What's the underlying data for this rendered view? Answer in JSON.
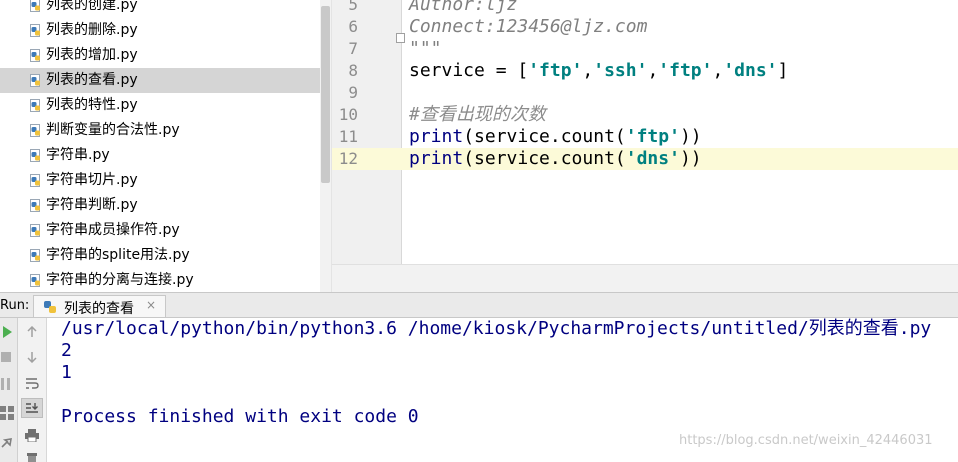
{
  "project_tree": {
    "items": [
      {
        "name": "列表的创建.py",
        "selected": false
      },
      {
        "name": "列表的删除.py",
        "selected": false
      },
      {
        "name": "列表的增加.py",
        "selected": false
      },
      {
        "name": "列表的查看.py",
        "selected": true
      },
      {
        "name": "列表的特性.py",
        "selected": false
      },
      {
        "name": "判断变量的合法性.py",
        "selected": false
      },
      {
        "name": "字符串.py",
        "selected": false
      },
      {
        "name": "字符串切片.py",
        "selected": false
      },
      {
        "name": "字符串判断.py",
        "selected": false
      },
      {
        "name": "字符串成员操作符.py",
        "selected": false
      },
      {
        "name": "字符串的splite用法.py",
        "selected": false
      },
      {
        "name": "字符串的分离与连接.py",
        "selected": false
      }
    ]
  },
  "editor": {
    "lines": [
      {
        "num": "5",
        "parts": [
          {
            "t": "docstr",
            "v": "Author:ljz"
          }
        ]
      },
      {
        "num": "6",
        "parts": [
          {
            "t": "docstr",
            "v": "Connect:123456@ljz.com"
          }
        ]
      },
      {
        "num": "7",
        "parts": [
          {
            "t": "docstr",
            "v": "\"\"\""
          }
        ]
      },
      {
        "num": "8",
        "parts": [
          {
            "t": "plain",
            "v": "service = ["
          },
          {
            "t": "str",
            "v": "'ftp'"
          },
          {
            "t": "plain",
            "v": ","
          },
          {
            "t": "str",
            "v": "'ssh'"
          },
          {
            "t": "plain",
            "v": ","
          },
          {
            "t": "str",
            "v": "'ftp'"
          },
          {
            "t": "plain",
            "v": ","
          },
          {
            "t": "str",
            "v": "'dns'"
          },
          {
            "t": "plain",
            "v": "]"
          }
        ]
      },
      {
        "num": "9",
        "parts": []
      },
      {
        "num": "10",
        "parts": [
          {
            "t": "comment",
            "v": "#查看出现的次数"
          }
        ]
      },
      {
        "num": "11",
        "parts": [
          {
            "t": "fn",
            "v": "print"
          },
          {
            "t": "plain",
            "v": "(service.count("
          },
          {
            "t": "str",
            "v": "'ftp'"
          },
          {
            "t": "plain",
            "v": "))"
          }
        ]
      },
      {
        "num": "12",
        "parts": [
          {
            "t": "fn",
            "v": "print"
          },
          {
            "t": "plain",
            "v": "(service.count("
          },
          {
            "t": "str",
            "v": "'dns'"
          },
          {
            "t": "plain",
            "v": "))"
          }
        ],
        "current": true
      }
    ]
  },
  "run": {
    "label": "Run:",
    "tab_label": "列表的查看",
    "tab_close": "×",
    "console": [
      {
        "cls": "c-cmd",
        "v": "/usr/local/python/bin/python3.6 /home/kiosk/PycharmProjects/untitled/列表的查看.py"
      },
      {
        "cls": "c-out",
        "v": "2"
      },
      {
        "cls": "c-out",
        "v": "1"
      },
      {
        "cls": "c-out",
        "v": ""
      },
      {
        "cls": "c-done",
        "v": "Process finished with exit code 0"
      }
    ]
  },
  "watermark": "https://blog.csdn.net/weixin_42446031",
  "colors": {
    "string": "#008080",
    "function": "#000080",
    "comment": "#8c8c8c",
    "selection": "#d5d5d5",
    "current_line": "#fcfad8"
  }
}
